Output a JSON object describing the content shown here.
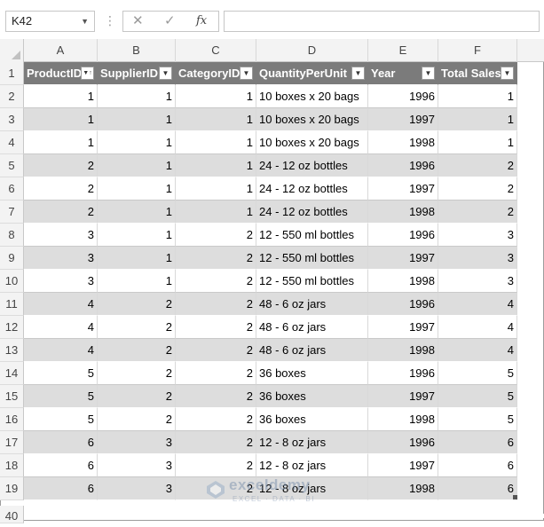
{
  "formula_bar": {
    "name_box": "K42",
    "more_glyph": "⋮",
    "cancel_glyph": "✕",
    "enter_glyph": "✓",
    "fx_label": "fx",
    "formula_value": ""
  },
  "columns": [
    "A",
    "B",
    "C",
    "D",
    "E",
    "F"
  ],
  "table": {
    "headers": [
      "ProductID",
      "SupplierID",
      "CategoryID",
      "QuantityPerUnit",
      "Year",
      "Total Sales"
    ],
    "sort_filter_column": 0,
    "rows": [
      [
        "1",
        "1",
        "1",
        "10 boxes x 20 bags",
        "1996",
        "1"
      ],
      [
        "1",
        "1",
        "1",
        "10 boxes x 20 bags",
        "1997",
        "1"
      ],
      [
        "1",
        "1",
        "1",
        "10 boxes x 20 bags",
        "1998",
        "1"
      ],
      [
        "2",
        "1",
        "1",
        "24 - 12 oz bottles",
        "1996",
        "2"
      ],
      [
        "2",
        "1",
        "1",
        "24 - 12 oz bottles",
        "1997",
        "2"
      ],
      [
        "2",
        "1",
        "1",
        "24 - 12 oz bottles",
        "1998",
        "2"
      ],
      [
        "3",
        "1",
        "2",
        "12 - 550 ml bottles",
        "1996",
        "3"
      ],
      [
        "3",
        "1",
        "2",
        "12 - 550 ml bottles",
        "1997",
        "3"
      ],
      [
        "3",
        "1",
        "2",
        "12 - 550 ml bottles",
        "1998",
        "3"
      ],
      [
        "4",
        "2",
        "2",
        "48 - 6 oz jars",
        "1996",
        "4"
      ],
      [
        "4",
        "2",
        "2",
        "48 - 6 oz jars",
        "1997",
        "4"
      ],
      [
        "4",
        "2",
        "2",
        "48 - 6 oz jars",
        "1998",
        "4"
      ],
      [
        "5",
        "2",
        "2",
        "36 boxes",
        "1996",
        "5"
      ],
      [
        "5",
        "2",
        "2",
        "36 boxes",
        "1997",
        "5"
      ],
      [
        "5",
        "2",
        "2",
        "36 boxes",
        "1998",
        "5"
      ],
      [
        "6",
        "3",
        "2",
        "12 - 8 oz jars",
        "1996",
        "6"
      ],
      [
        "6",
        "3",
        "2",
        "12 - 8 oz jars",
        "1997",
        "6"
      ],
      [
        "6",
        "3",
        "2",
        "12 - 8 oz jars",
        "1998",
        "6"
      ]
    ]
  },
  "row_numbers": [
    "1",
    "2",
    "3",
    "4",
    "5",
    "6",
    "7",
    "8",
    "9",
    "10",
    "11",
    "12",
    "13",
    "14",
    "15",
    "16",
    "17",
    "18",
    "19",
    "40"
  ],
  "watermark": {
    "name": "exceldemy",
    "tagline": "EXCEL · DATA · BI"
  },
  "colors": {
    "header_bg": "#7b7b7b",
    "band_bg": "#dddddd",
    "grid_header_bg": "#f3f3f3"
  }
}
